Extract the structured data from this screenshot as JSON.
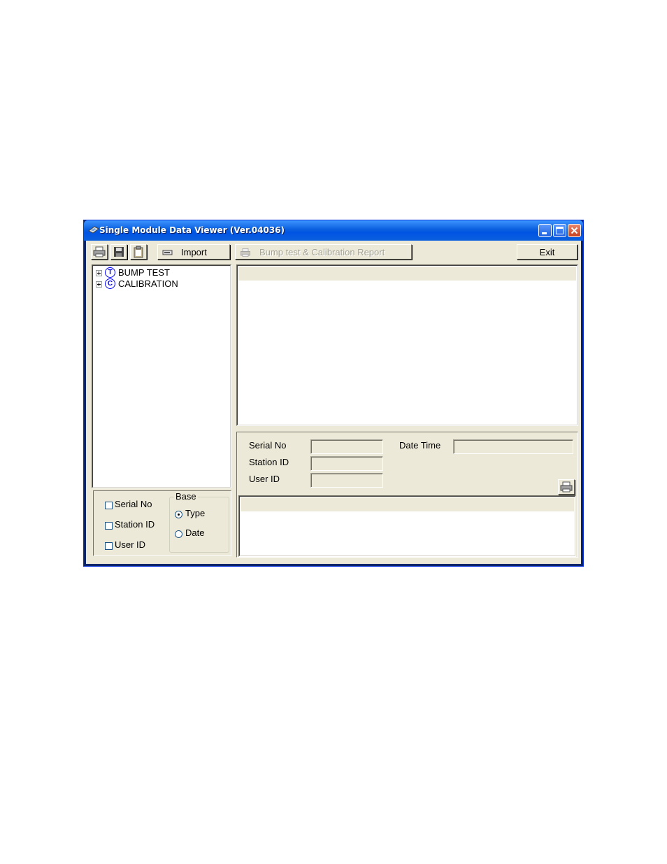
{
  "window": {
    "title": "Single Module Data Viewer (Ver.04036)",
    "title_icon": "pager-icon",
    "controls": [
      "minimize-icon",
      "maximize-icon",
      "close-icon"
    ]
  },
  "toolbar": {
    "icon_buttons": [
      "print-icon",
      "save-icon",
      "clipboard-icon"
    ],
    "import_label": "Import",
    "import_icon": "import-icon",
    "report_label": "Bump test & Calibration Report",
    "report_icon": "print-icon",
    "report_enabled": false,
    "exit_label": "Exit"
  },
  "tree": {
    "items": [
      {
        "badge": "T",
        "label": "BUMP TEST"
      },
      {
        "badge": "C",
        "label": "CALIBRATION"
      }
    ]
  },
  "filters": {
    "checkboxes": [
      {
        "label": "Serial No",
        "checked": false
      },
      {
        "label": "Station ID",
        "checked": false
      },
      {
        "label": "User ID",
        "checked": false
      }
    ],
    "base": {
      "title": "Base",
      "options": [
        {
          "label": "Type",
          "selected": true
        },
        {
          "label": "Date",
          "selected": false
        }
      ]
    }
  },
  "details": {
    "serial_no_label": "Serial No",
    "station_id_label": "Station ID",
    "user_id_label": "User ID",
    "date_time_label": "Date Time",
    "serial_no_value": "",
    "station_id_value": "",
    "user_id_value": "",
    "date_time_value": "",
    "print_icon": "print-icon"
  },
  "colors": {
    "titlebar": "#0054e3",
    "client": "#ece9d8",
    "tree_badge": "#0000ff",
    "disabled_text": "#a4a396"
  }
}
